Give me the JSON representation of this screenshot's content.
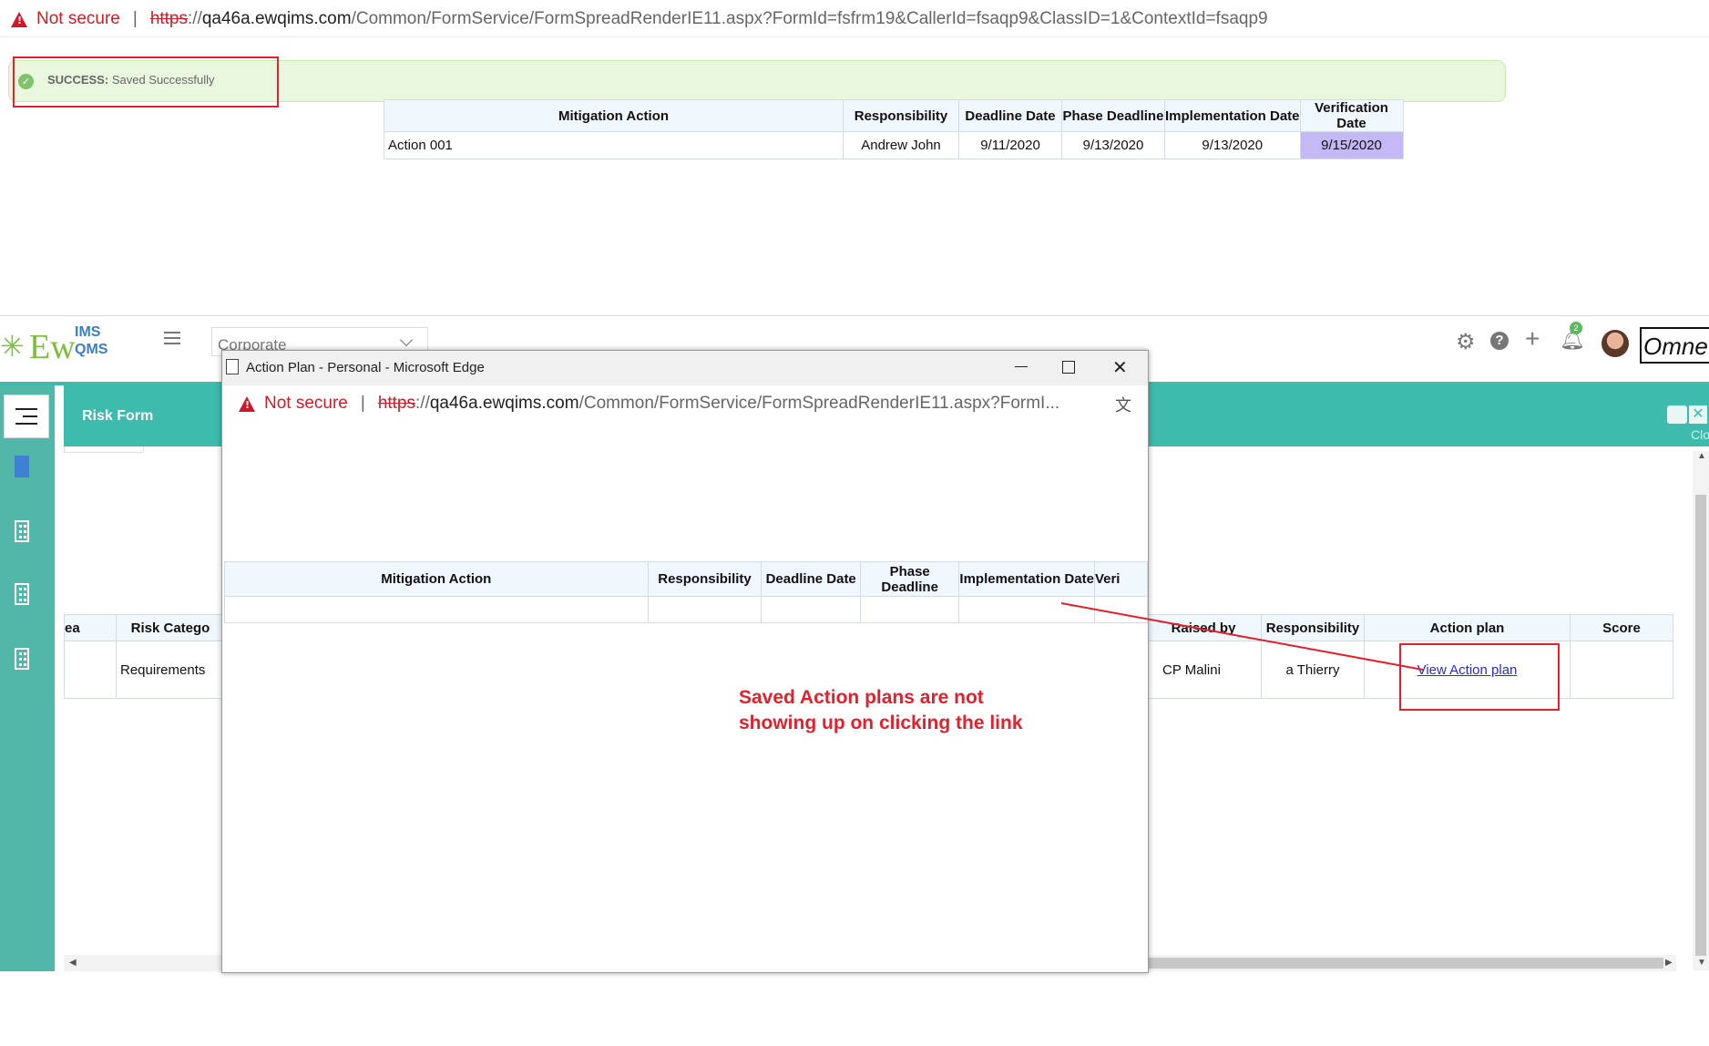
{
  "browser_top": {
    "not_secure": "Not secure",
    "url_scheme": "https",
    "url_sep": "://",
    "url_host": "qa46a.ewqims.com",
    "url_path": "/Common/FormService/FormSpreadRenderIE11.aspx?FormId=fsfrm19&CallerId=fsaqp9&ClassID=1&ContextId=fsaqp9"
  },
  "success_banner": {
    "label": "SUCCESS:",
    "message": "Saved Successfully"
  },
  "top_table": {
    "headers": [
      "Mitigation Action",
      "Responsibility",
      "Deadline Date",
      "Phase Deadline",
      "Implementation Date",
      "Verification Date"
    ],
    "rows": [
      [
        "Action 001",
        "Andrew John",
        "9/11/2020",
        "9/13/2020",
        "9/13/2020",
        "9/15/2020"
      ]
    ]
  },
  "app": {
    "logo_text": "Ew",
    "logo_ims": "IMS",
    "logo_qms": "QMS",
    "location": "Corporate",
    "notification_count": "2",
    "brand_text": "Omne",
    "form_title": "Risk Form",
    "close_text": "Clo",
    "grid": {
      "headers_left": [
        "ea",
        "Risk Catego"
      ],
      "headers_right": [
        "Raised by",
        "Responsibility",
        "Action plan",
        "Score"
      ],
      "row_left": [
        "",
        "Requirements"
      ],
      "row_right": [
        "CP Malini",
        "a Thierry",
        "View Action plan",
        ""
      ]
    }
  },
  "popup": {
    "title": "Action Plan - Personal - Microsoft Edge",
    "not_secure": "Not secure",
    "url_scheme": "https",
    "url_sep": "://",
    "url_host": "qa46a.ewqims.com",
    "url_path": "/Common/FormService/FormSpreadRenderIE11.aspx?FormI...",
    "table_headers": [
      "Mitigation Action",
      "Responsibility",
      "Deadline Date",
      "Phase Deadline",
      "Implementation Date",
      "Veri"
    ]
  },
  "annotation": {
    "line1": "Saved Action plans are not",
    "line2": "showing up on clicking the link",
    "color": "#e3202b"
  },
  "colors": {
    "teal": "#3dbbac",
    "alert_red": "#d0182b",
    "success_bg": "#e9f7df",
    "highlight_cell": "#c5b9f5"
  }
}
